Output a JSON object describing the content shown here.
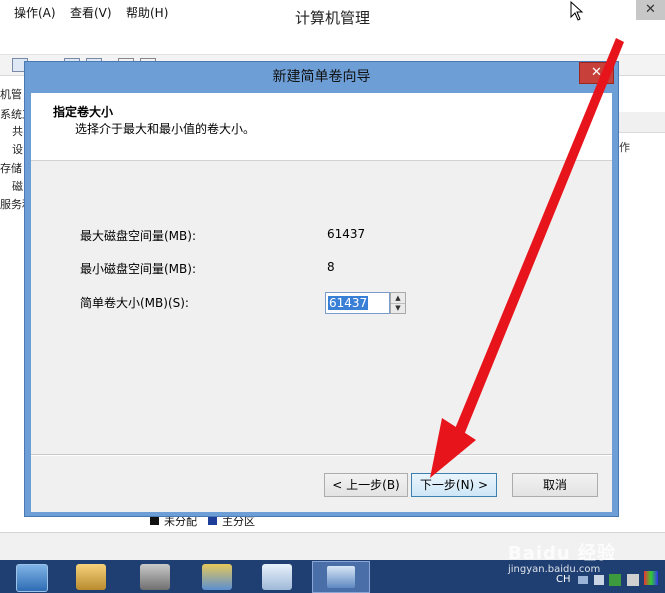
{
  "background_window": {
    "title": "计算机管理",
    "close_glyph": "✕",
    "menu": [
      "操作(A)",
      "查看(V)",
      "帮助(H)"
    ],
    "tree_items": [
      "机管",
      "系统工",
      "共",
      "设",
      "存储",
      "磁",
      "服务和"
    ],
    "side_text": "作",
    "legend": [
      "未分配",
      "主分区"
    ]
  },
  "dialog": {
    "title": "新建简单卷向导",
    "close_glyph": "✕",
    "header_title": "指定卷大小",
    "header_subtitle": "选择介于最大和最小值的卷大小。",
    "fields": {
      "max_label": "最大磁盘空间量(MB):",
      "max_value": "61437",
      "min_label": "最小磁盘空间量(MB):",
      "min_value": "8",
      "size_label": "简单卷大小(MB)(S):",
      "size_value": "61437"
    },
    "buttons": {
      "back": "< 上一步(B)",
      "next": "下一步(N) >",
      "cancel": "取消"
    }
  },
  "taskbar": {
    "tray_lang": "CH"
  },
  "watermark": {
    "brand": "Baidu 经验",
    "url": "jingyan.baidu.com"
  },
  "colors": {
    "dialog_frame": "#6d9ed6",
    "taskbar": "#1f3f72",
    "arrow": "#e8141b"
  }
}
